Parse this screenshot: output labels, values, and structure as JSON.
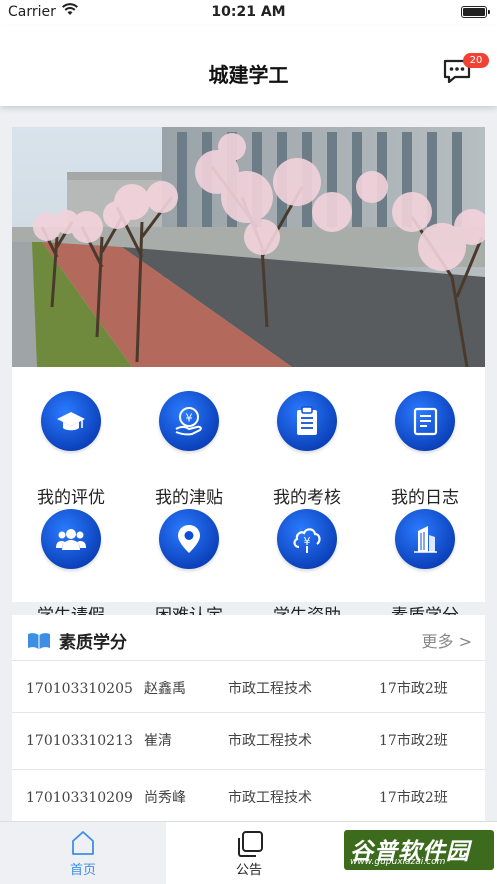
{
  "status_bar": {
    "carrier": "Carrier",
    "time": "10:21 AM"
  },
  "header": {
    "title": "城建学工",
    "message_badge": "20"
  },
  "grid": {
    "items": [
      {
        "label": "我的评优",
        "icon": "graduation-cap-icon"
      },
      {
        "label": "我的津贴",
        "icon": "yen-hand-icon"
      },
      {
        "label": "我的考核",
        "icon": "clipboard-icon"
      },
      {
        "label": "我的日志",
        "icon": "notebook-icon"
      },
      {
        "label": "学生请假",
        "icon": "users-icon"
      },
      {
        "label": "困难认定",
        "icon": "location-pin-icon"
      },
      {
        "label": "学生资助",
        "icon": "yen-cloud-icon"
      },
      {
        "label": "素质学分",
        "icon": "building-icon"
      }
    ]
  },
  "credits": {
    "title": "素质学分",
    "more": "更多 >",
    "rows": [
      {
        "id": "170103310205",
        "name": "赵鑫禹",
        "major": "市政工程技术",
        "class": "17市政2班"
      },
      {
        "id": "170103310213",
        "name": "崔清",
        "major": "市政工程技术",
        "class": "17市政2班"
      },
      {
        "id": "170103310209",
        "name": "尚秀峰",
        "major": "市政工程技术",
        "class": "17市政2班"
      }
    ]
  },
  "tabbar": {
    "home": "首页",
    "notice": "公告"
  },
  "watermark": {
    "main": "谷普软件园",
    "url": "www.gupuxiazai.com"
  },
  "colors": {
    "accent": "#3d8fe6",
    "icon_blue": "#0b4fd6",
    "badge": "#f04134"
  }
}
